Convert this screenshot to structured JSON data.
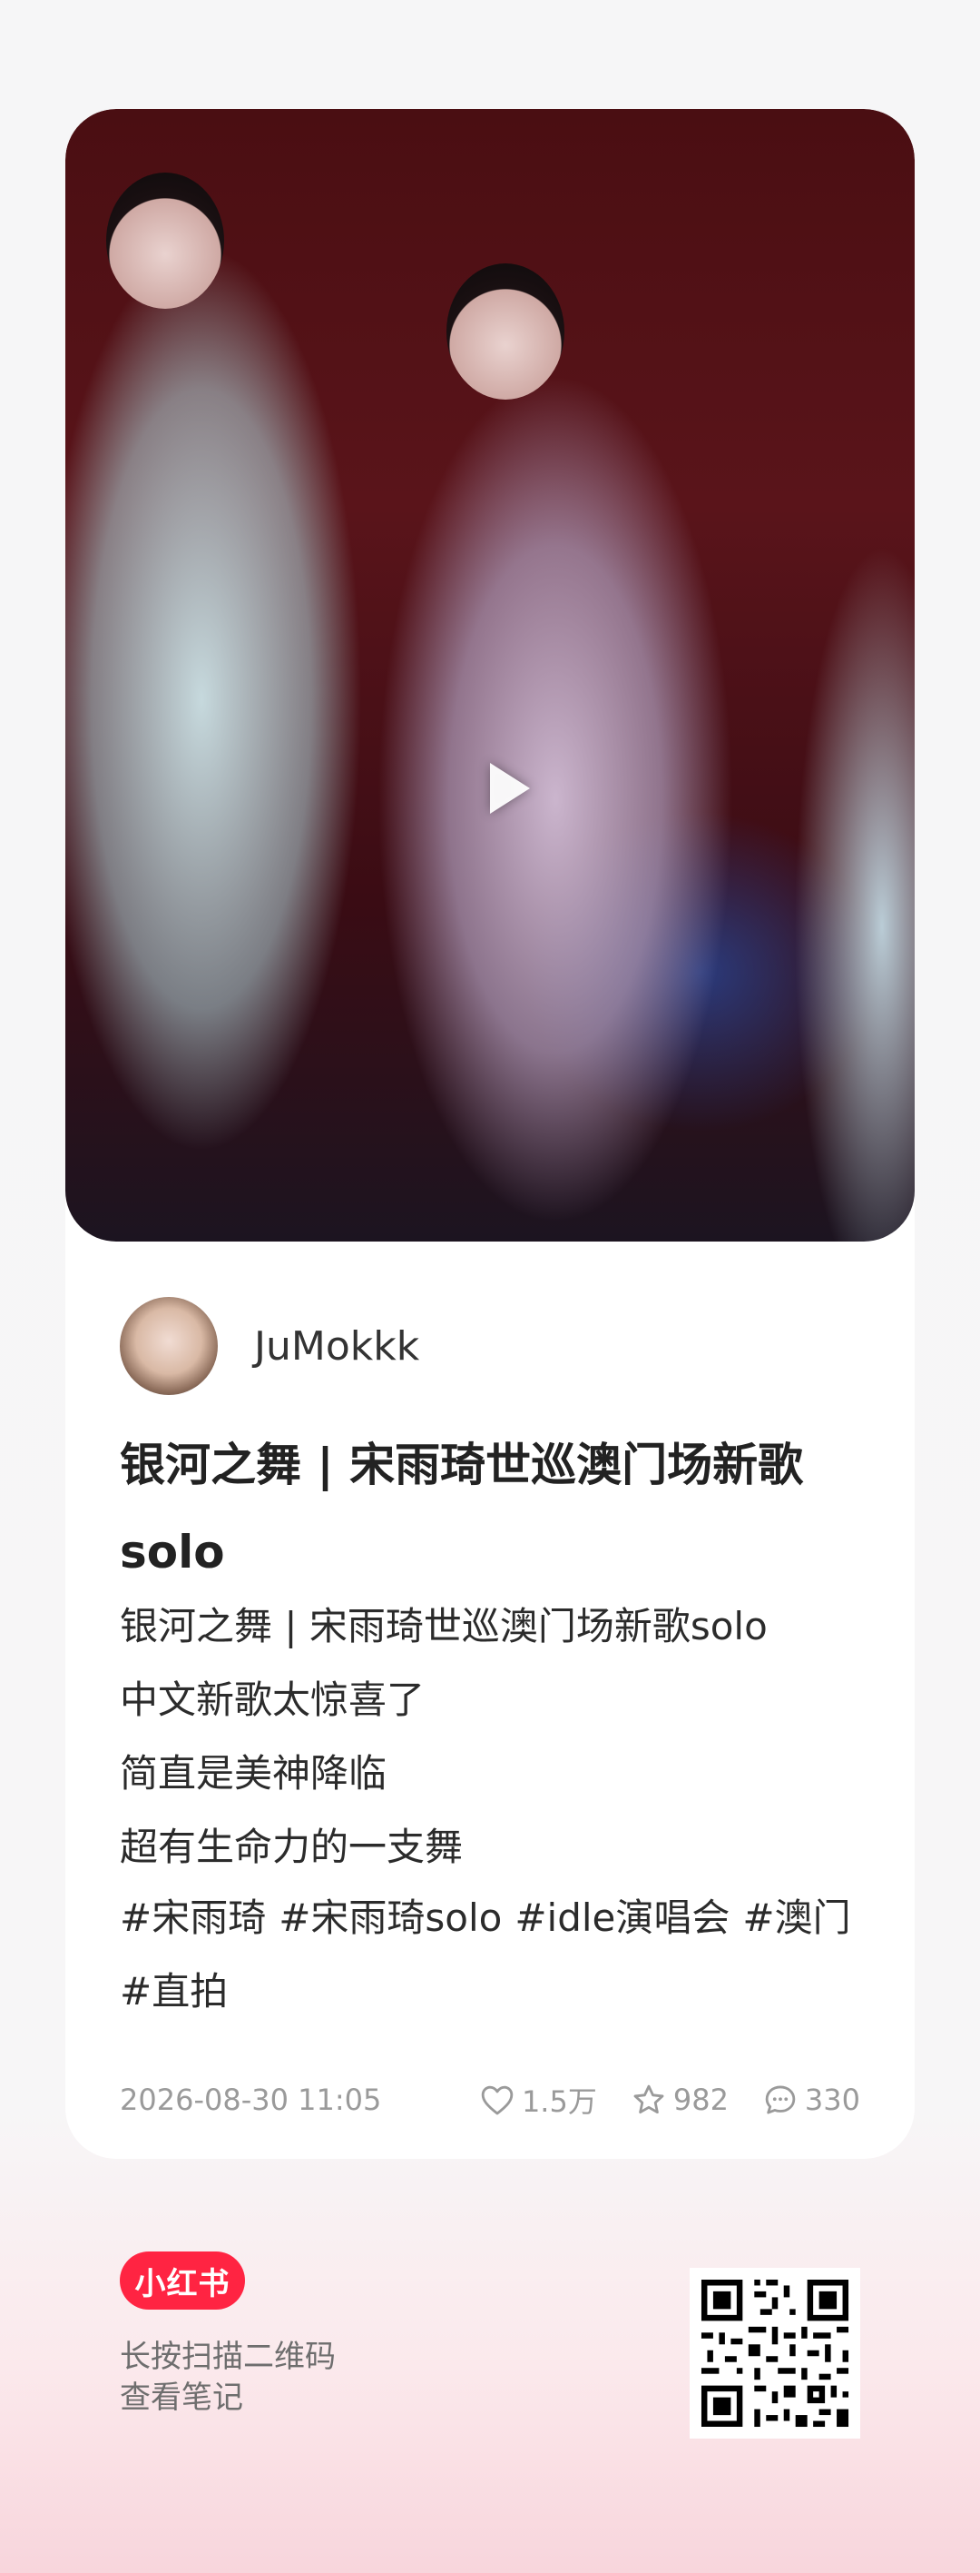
{
  "author": {
    "name": "JuMokkk"
  },
  "post": {
    "title": "银河之舞 | 宋雨琦世巡澳门场新歌solo",
    "body_lines": [
      "银河之舞 | 宋雨琦世巡澳门场新歌solo",
      "中文新歌太惊喜了",
      "简直是美神降临",
      "超有生命力的一支舞"
    ],
    "tags": [
      "#宋雨琦",
      "#宋雨琦solo",
      "#idle演唱会",
      "#澳门",
      "#直拍"
    ]
  },
  "meta": {
    "date": "2026-08-30 11:05",
    "likes": "1.5万",
    "collects": "982",
    "comments": "330"
  },
  "footer": {
    "logo_text": "小红书",
    "hint_line1": "长按扫描二维码",
    "hint_line2": "查看笔记"
  },
  "colors": {
    "brand": "#ff2442",
    "meta_gray": "#9a9a9a"
  }
}
